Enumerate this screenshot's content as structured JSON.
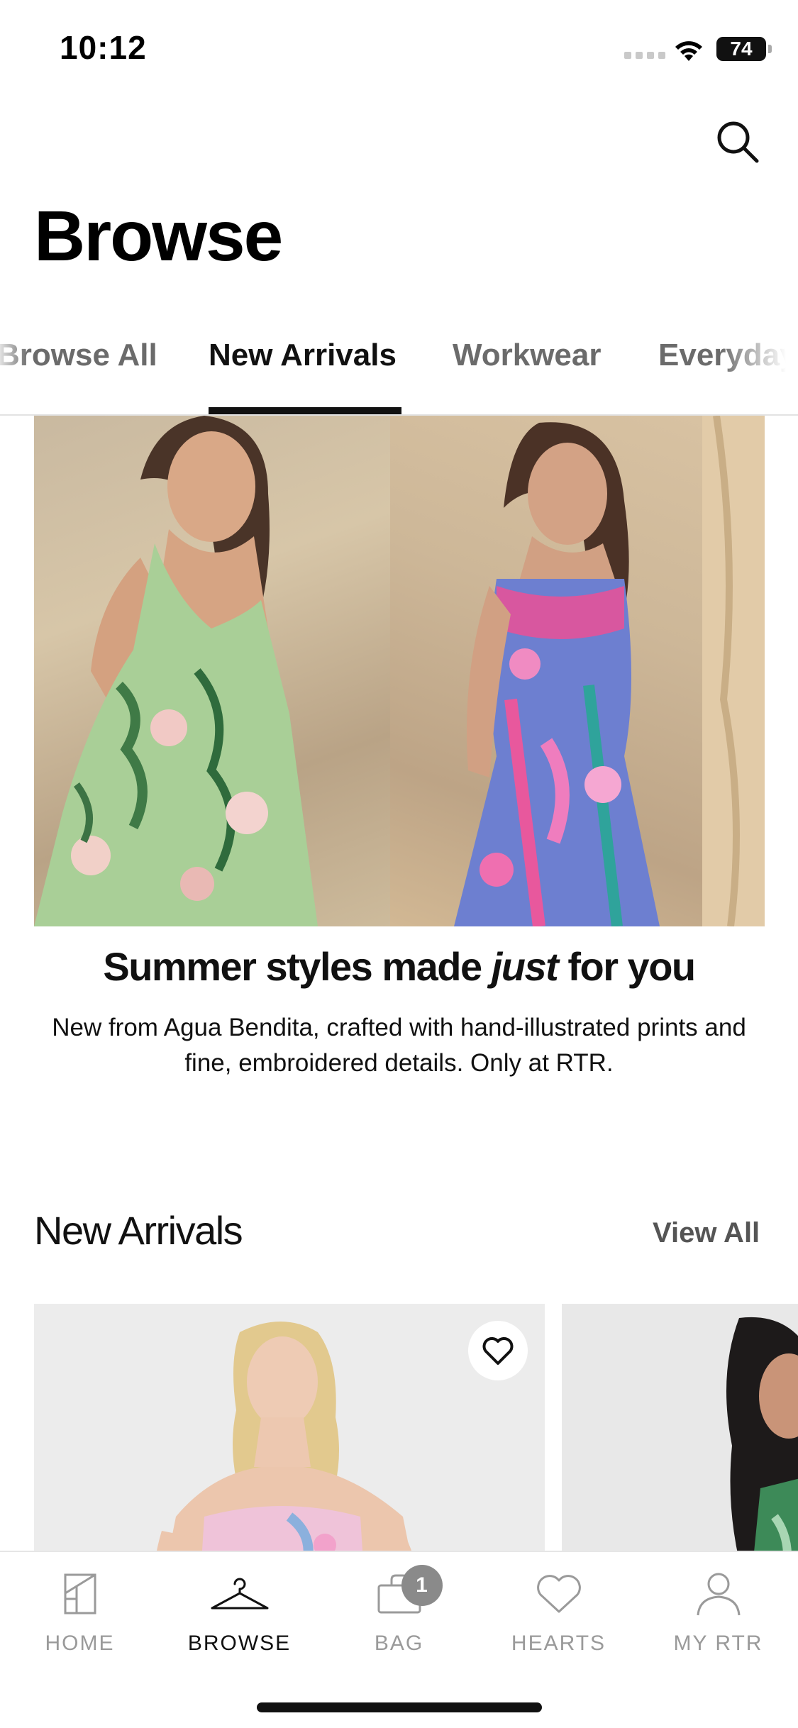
{
  "status": {
    "time": "10:12",
    "battery": "74"
  },
  "header": {
    "title": "Browse"
  },
  "tabs": [
    {
      "label": "Browse All"
    },
    {
      "label": "New Arrivals"
    },
    {
      "label": "Workwear"
    },
    {
      "label": "Everyday"
    }
  ],
  "hero": {
    "heading_before": "Summer styles made ",
    "heading_emphasis": "just",
    "heading_after": " for you",
    "subtext": "New from Agua Bendita, crafted with hand-illustrated prints and fine, embroidered details. Only at RTR."
  },
  "new_arrivals": {
    "title": "New Arrivals",
    "view_all": "View All"
  },
  "bottom_nav": {
    "items": [
      {
        "label": "HOME",
        "icon": "home-icon"
      },
      {
        "label": "BROWSE",
        "icon": "hanger-icon"
      },
      {
        "label": "BAG",
        "icon": "bag-icon",
        "badge": "1"
      },
      {
        "label": "HEARTS",
        "icon": "heart-icon"
      },
      {
        "label": "MY RTR",
        "icon": "profile-icon"
      }
    ],
    "active": "BROWSE"
  },
  "colors": {
    "accent": "#111111",
    "muted": "#9a9a9a",
    "badge": "#8a8a8a"
  }
}
